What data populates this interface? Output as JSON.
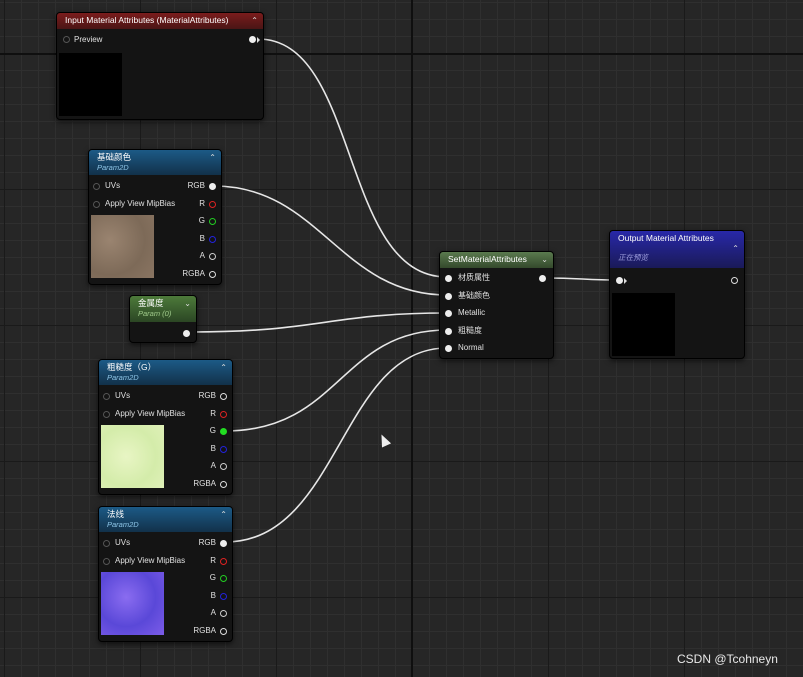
{
  "nodes": {
    "input_attrs": {
      "title": "Input Material Attributes (MaterialAttributes)",
      "preview_label": "Preview"
    },
    "base_color": {
      "title": "基础颜色",
      "subtitle": "Param2D",
      "uvs": "UVs",
      "mip": "Apply View MipBias",
      "outputs": [
        "RGB",
        "R",
        "G",
        "B",
        "A",
        "RGBA"
      ]
    },
    "metalness": {
      "title": "金属度",
      "subtitle": "Param (0)"
    },
    "roughness": {
      "title": "粗糙度（G）",
      "subtitle": "Param2D",
      "uvs": "UVs",
      "mip": "Apply View MipBias",
      "outputs": [
        "RGB",
        "R",
        "G",
        "B",
        "A",
        "RGBA"
      ]
    },
    "normal": {
      "title": "法线",
      "subtitle": "Param2D",
      "uvs": "UVs",
      "mip": "Apply View MipBias",
      "outputs": [
        "RGB",
        "R",
        "G",
        "B",
        "A",
        "RGBA"
      ]
    },
    "set_attrs": {
      "title": "SetMaterialAttributes",
      "inputs": [
        "材质属性",
        "基础颜色",
        "Metallic",
        "粗糙度",
        "Normal"
      ]
    },
    "output_attrs": {
      "title": "Output Material Attributes",
      "subtitle": "正在预览"
    }
  },
  "watermark": "CSDN @Tcohneyn",
  "colors": {
    "wire": "#e6e6e6",
    "bg": "#262626"
  },
  "icons": {
    "chevron": "chevron-up-icon",
    "pin": "pin-icon"
  }
}
